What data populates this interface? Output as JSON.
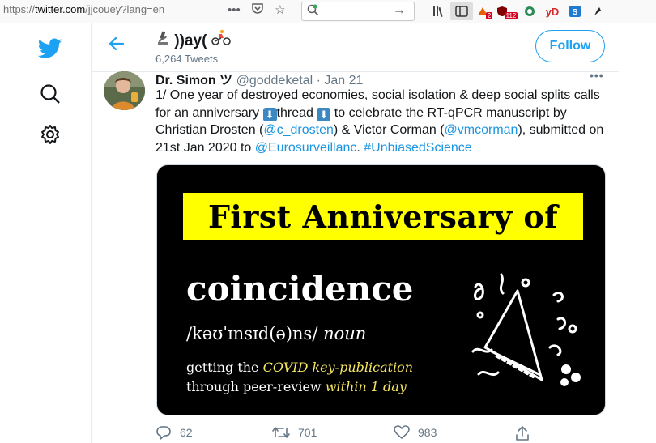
{
  "browser": {
    "url_protocol": "https://",
    "url_host": "twitter.com",
    "url_path": "/jjcouey?lang=en",
    "toolbar_badge_1": "2",
    "toolbar_badge_2": "112",
    "toolbar_text_yd": "yD"
  },
  "nav": {
    "items": [
      "twitter-logo",
      "search",
      "settings"
    ]
  },
  "header": {
    "account_name": "))ay(",
    "tweet_count": "6,264 Tweets",
    "follow_label": "Follow",
    "back_icon": "back-arrow-icon"
  },
  "tweet": {
    "author_name": "Dr. Simon ツ",
    "author_handle": "@goddeketal",
    "separator": "·",
    "date": "Jan 21",
    "more": "•••",
    "text": {
      "p1": "1/ One year of destroyed economies, social isolation & deep social splits calls for an anniversary ",
      "p2": "thread ",
      "p3": " to celebrate the RT-qPCR manuscript by Christian Drosten (",
      "link1": "@c_drosten",
      "p4": ") & Victor Corman (",
      "link2": "@vmcorman",
      "p5": "), submitted on 21st Jan 2020 to ",
      "link3": "@Eurosurveillanc",
      "p6": ". ",
      "link4": "#UnbiasedScience"
    },
    "media": {
      "banner": "First Anniversary of",
      "word": "coincidence",
      "phonetic": "/kəʊˈɪnsɪd(ə)ns/",
      "pos": "noun",
      "def_a": "getting the ",
      "def_b": "COVID key-publication",
      "def_c": "through peer-review ",
      "def_d": "within 1 day"
    },
    "actions": {
      "replies": "62",
      "retweets": "701",
      "likes": "983"
    }
  },
  "colors": {
    "twitter_blue": "#1da1f2",
    "banner_yellow": "#ffff00",
    "highlight_yellow": "#f5e663"
  }
}
